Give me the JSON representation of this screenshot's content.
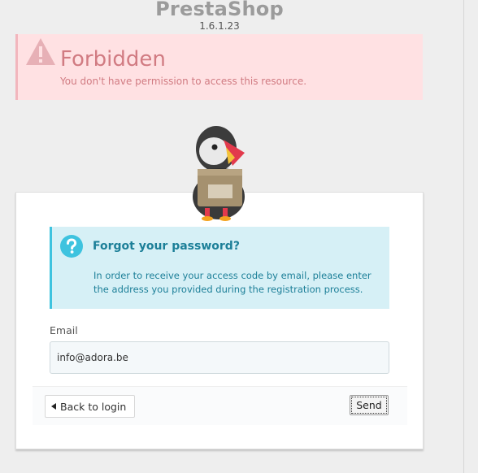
{
  "brand": {
    "name": "PrestaShop",
    "version": "1.6.1.23"
  },
  "alert": {
    "title": "Forbidden",
    "message": "You don't have permission to access this resource.",
    "icon": "warning-icon"
  },
  "forgot": {
    "heading": "Forgot your password?",
    "body": "In order to receive your access code by email, please enter the address you provided during the registration process.",
    "icon": "question-icon"
  },
  "form": {
    "email_label": "Email",
    "email_value": "info@adora.be"
  },
  "actions": {
    "back_label": "Back to login",
    "send_label": "Send"
  },
  "colors": {
    "alert_bg": "#ffe1e3",
    "alert_text": "#d17b82",
    "info_bg": "#d6f0f6",
    "info_text": "#1c7f98",
    "info_icon": "#3ec3df"
  }
}
